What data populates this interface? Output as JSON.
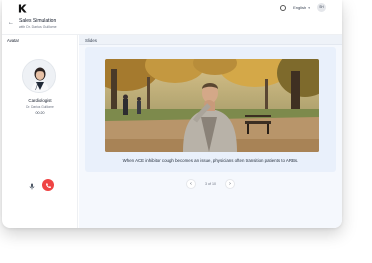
{
  "topbar": {
    "language": "English",
    "user_initials": "SH"
  },
  "header": {
    "title": "Sales Simulation",
    "subtitle": "with Dr. Darius Guillome"
  },
  "left_panel": {
    "label": "Avatar",
    "role": "Cardiologist",
    "doctor_name": "Dr. Darius Guillome",
    "timer": "00:20"
  },
  "slides": {
    "label": "Slides",
    "caption": "When ACE inhibitor cough becomes an issue, physicians often transition patients to ARBs.",
    "pager_text": "3 of 10"
  },
  "colors": {
    "end_call": "#ef4444",
    "accent": "#e9f0fb"
  }
}
